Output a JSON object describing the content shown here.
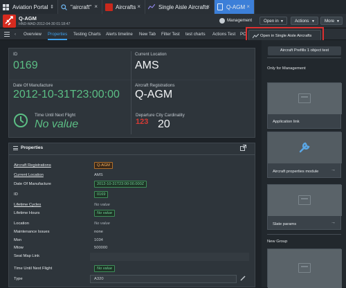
{
  "tabs": [
    {
      "label": "Aviation Portal",
      "icon": "grid-icon"
    },
    {
      "label": "\"aircraft\"",
      "icon": "search-icon"
    },
    {
      "label": "Aircrafts",
      "icon": "red-app-icon"
    },
    {
      "label": "Single Aisle Aircrafts",
      "icon": "chart-icon"
    },
    {
      "label": "Q-AGM",
      "icon": "document-icon"
    }
  ],
  "header": {
    "title": "Q-AGM",
    "subtitle": "HND-MAD-2012-04-30 01:18:47",
    "management_label": "Management",
    "open_in_label": "Open in",
    "actions_label": "Actions",
    "more_label": "More"
  },
  "dropdown": {
    "item_label": "Open in Single Aisle Aircrafts"
  },
  "nav_tabs": [
    "Overview",
    "Properties",
    "Testing Charts",
    "Alerts timeline",
    "New Tab",
    "Filter Test",
    "test charts",
    "Actions Test",
    "PC"
  ],
  "active_nav_tab": "Properties",
  "summary": {
    "id_label": "ID",
    "id_value": "0169",
    "location_label": "Current Location",
    "location_value": "AMS",
    "manufacture_label": "Date Of Manufacture",
    "manufacture_value": "2012-10-31T23:00:00",
    "registrations_label": "Aircraft Registrations",
    "registrations_value": "Q-AGM",
    "next_flight_label": "Time Until Next Flight",
    "next_flight_value": "No value",
    "departure_label": "Departure City Cardinality",
    "departure_value": "20",
    "departure_badge": "123"
  },
  "properties": {
    "title": "Properties",
    "rows": [
      {
        "label": "Aircraft Registrations",
        "value": "Q-AGM"
      },
      {
        "label": "Current Location",
        "value": "AMS"
      },
      {
        "label": "Date Of Manufacture",
        "value": "2012-10-31T23:00:00.000Z"
      },
      {
        "label": "ID",
        "value": "0169"
      },
      {
        "label": "Lifetime Cycles",
        "value": "No value"
      },
      {
        "label": "Lifetime Hours",
        "value": "No value"
      },
      {
        "label": "Location",
        "value": "No value"
      },
      {
        "label": "Maintenance Issues",
        "value": "none"
      },
      {
        "label": "Msn",
        "value": "1034"
      },
      {
        "label": "Mtow",
        "value": "500000"
      },
      {
        "label": "Seat Map Link",
        "value": ""
      },
      {
        "label": "Time Until Next Flight",
        "value": "No value"
      },
      {
        "label": "Type",
        "value": "A320"
      }
    ]
  },
  "right": {
    "prefills_label": "Aircraft Prefills 1 object test",
    "management_heading": "Only for Management",
    "application_link": "Application link",
    "aircraft_properties_module": "Aircraft properties module",
    "slate_params": "Slate params",
    "new_group": "New Group"
  },
  "colors": {
    "accent": "#3ea0ec",
    "brand_red": "#d62b1f",
    "highlight": "#e03030",
    "value_green": "#5cbf85"
  }
}
